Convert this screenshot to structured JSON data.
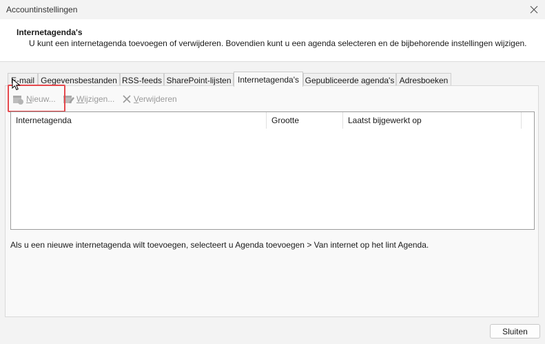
{
  "window": {
    "title": "Accountinstellingen"
  },
  "header": {
    "title": "Internetagenda's",
    "description": "U kunt een internetagenda toevoegen of verwijderen. Bovendien kunt u een agenda selecteren en de bijbehorende instellingen wijzigen."
  },
  "tabs": [
    {
      "label": "E-mail"
    },
    {
      "label": "Gegevensbestanden"
    },
    {
      "label": "RSS-feeds"
    },
    {
      "label": "SharePoint-lijsten"
    },
    {
      "label": "Internetagenda's",
      "active": true
    },
    {
      "label": "Gepubliceerde agenda's"
    },
    {
      "label": "Adresboeken"
    }
  ],
  "toolbar": {
    "new": {
      "label_prefix": "",
      "label_u": "N",
      "label_rest": "ieuw...",
      "icon": "calendar-add-icon",
      "enabled": false
    },
    "edit": {
      "label_u": "W",
      "label_rest": "ijzigen...",
      "icon": "calendar-edit-icon",
      "enabled": false
    },
    "remove": {
      "label_u": "V",
      "label_rest": "erwijderen",
      "icon": "x-icon",
      "enabled": false
    }
  },
  "list": {
    "columns": [
      "Internetagenda",
      "Grootte",
      "Laatst bijgewerkt op"
    ],
    "rows": []
  },
  "hint": "Als u een nieuwe internetagenda wilt toevoegen, selecteert u Agenda toevoegen > Van internet op het lint Agenda.",
  "footer": {
    "close_label": "Sluiten"
  },
  "colors": {
    "highlight": "#e5484d",
    "disabled_text": "#9a9a9a"
  }
}
